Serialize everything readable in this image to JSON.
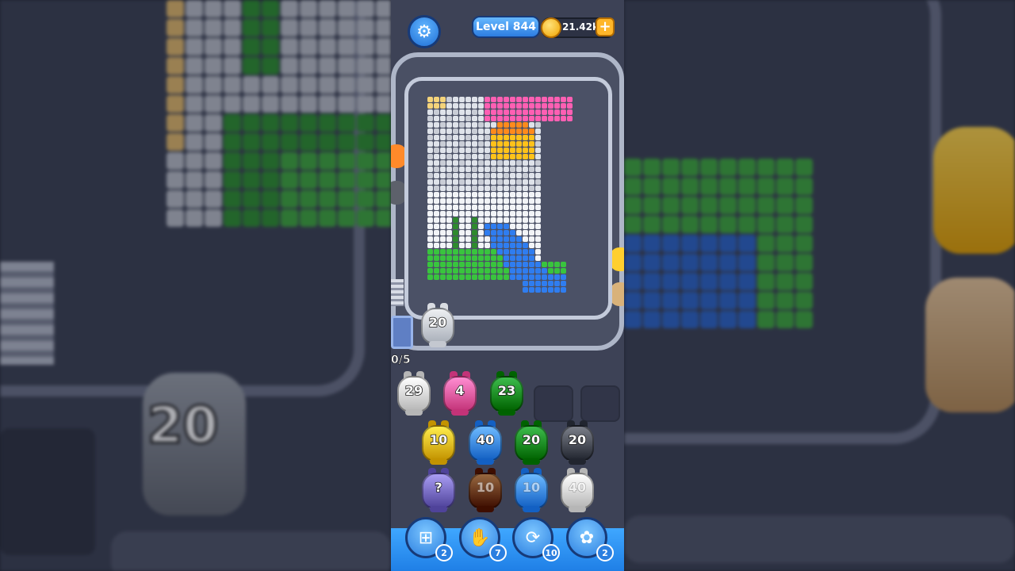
{
  "header": {
    "level_label": "Level 844",
    "coins": "21.42k",
    "add_coins": "+"
  },
  "icons": {
    "settings": "gear-icon"
  },
  "track": {
    "pig_count": "20",
    "counter": "0/5"
  },
  "queue": [
    {
      "count": "29",
      "color": "#f2f2f2"
    },
    {
      "count": "4",
      "color": "#ff6fb4"
    },
    {
      "count": "23",
      "color": "#1f9e2e"
    }
  ],
  "grid": [
    [
      {
        "count": "10",
        "color": "#ffcf2e"
      },
      {
        "count": "40",
        "color": "#4f9cff"
      },
      {
        "count": "20",
        "color": "#1f9e2e"
      },
      {
        "count": "20",
        "color": "#5d616b"
      }
    ],
    [
      {
        "count": "?",
        "color": "#8b7fd6"
      },
      {
        "count": "10",
        "color": "#7a4a22"
      },
      {
        "count": "10",
        "color": "#4f9cff"
      },
      {
        "count": "40",
        "color": "#f2f2f2"
      }
    ]
  ],
  "boosters": [
    {
      "name": "add-slot",
      "icon": "add-slot-icon",
      "count": "2"
    },
    {
      "name": "hand",
      "icon": "hand-icon",
      "count": "7"
    },
    {
      "name": "shuffle",
      "icon": "shuffle-icon",
      "count": "10"
    },
    {
      "name": "pig",
      "icon": "pig-icon",
      "count": "2"
    }
  ],
  "background": {
    "pig_number": "20"
  }
}
